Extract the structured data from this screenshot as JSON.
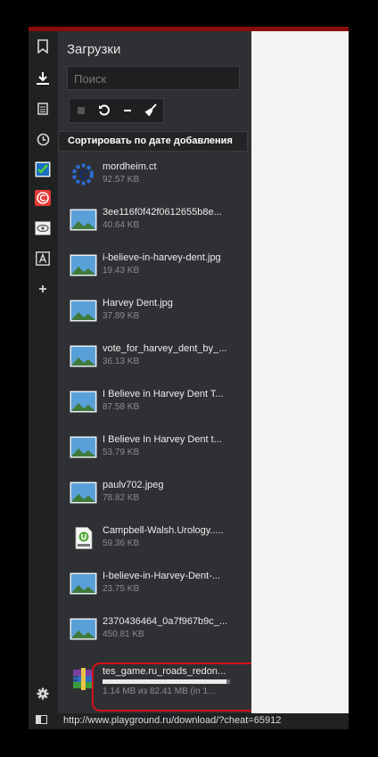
{
  "panel": {
    "title": "Загрузки",
    "search_placeholder": "Поиск",
    "sort_label": "Сортировать по дате добавления"
  },
  "toolbar": {
    "stop_icon": "stop-icon",
    "retry_icon": "retry-icon",
    "remove_icon": "remove-icon",
    "clean_icon": "broom-icon"
  },
  "sidebar_icons": [
    "bookmark-icon",
    "download-icon",
    "notes-icon",
    "history-icon",
    "checklist-app-icon",
    "copyright-app-icon",
    "eye-app-icon",
    "font-app-icon",
    "add-panel-icon",
    "settings-icon"
  ],
  "downloads": [
    {
      "name": "mordheim.ct",
      "size": "92.57 KB",
      "icon": "cheat-engine-icon"
    },
    {
      "name": "3ee116f0f42f0612655b8e...",
      "size": "40.64 KB",
      "icon": "image-file-icon"
    },
    {
      "name": "i-believe-in-harvey-dent.jpg",
      "size": "19.43 KB",
      "icon": "image-file-icon"
    },
    {
      "name": "Harvey Dent.jpg",
      "size": "37.89 KB",
      "icon": "image-file-icon"
    },
    {
      "name": "vote_for_harvey_dent_by_...",
      "size": "36.13 KB",
      "icon": "image-file-icon"
    },
    {
      "name": "I Believe in Harvey Dent T...",
      "size": "87.58 KB",
      "icon": "image-file-icon"
    },
    {
      "name": "I Believe In Harvey Dent t...",
      "size": "53.79 KB",
      "icon": "image-file-icon"
    },
    {
      "name": "paulv702.jpeg",
      "size": "78.82 KB",
      "icon": "image-file-icon"
    },
    {
      "name": "Campbell-Walsh.Urology.....",
      "size": "59.36 KB",
      "icon": "utorrent-file-icon"
    },
    {
      "name": "I-believe-in-Harvey-Dent-...",
      "size": "23.75 KB",
      "icon": "image-file-icon"
    },
    {
      "name": "2370436464_0a7f967b9c_...",
      "size": "450.81 KB",
      "icon": "image-file-icon"
    },
    {
      "name": "tes_game.ru_roads_redon...",
      "size": "1.14 MB из 82.41 MB (in 1...",
      "icon": "winrar-archive-icon",
      "progress": 0.97
    }
  ],
  "status_url": "http://www.playground.ru/download/?cheat=65912",
  "colors": {
    "accent_red": "#d4111c",
    "panel_bg": "#2e3033",
    "sidebar_bg": "#1f2123"
  }
}
